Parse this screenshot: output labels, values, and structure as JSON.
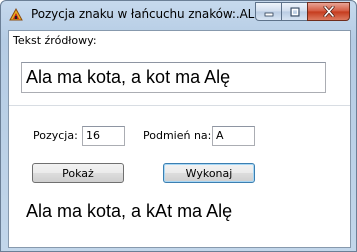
{
  "window": {
    "title": "Pozycja znaku w łańcuchu znaków:.AL"
  },
  "caption": {
    "minimize_icon": "minimize-icon",
    "maximize_icon": "maximize-icon",
    "close_icon": "close-icon"
  },
  "source": {
    "label": "Tekst źródłowy:",
    "value": "Ala ma kota, a kot ma Alę"
  },
  "position": {
    "label": "Pozycja:",
    "value": "16"
  },
  "replace": {
    "label": "Podmień na:",
    "value": "A"
  },
  "buttons": {
    "show_label": "Pokaż",
    "execute_label": "Wykonaj"
  },
  "result": {
    "text": "Ala ma kota, a kAt ma Alę"
  },
  "colors": {
    "close_button": "#c53a1c",
    "title_bar": "#b5cce4",
    "default_button_border": "#3c7fb1"
  }
}
